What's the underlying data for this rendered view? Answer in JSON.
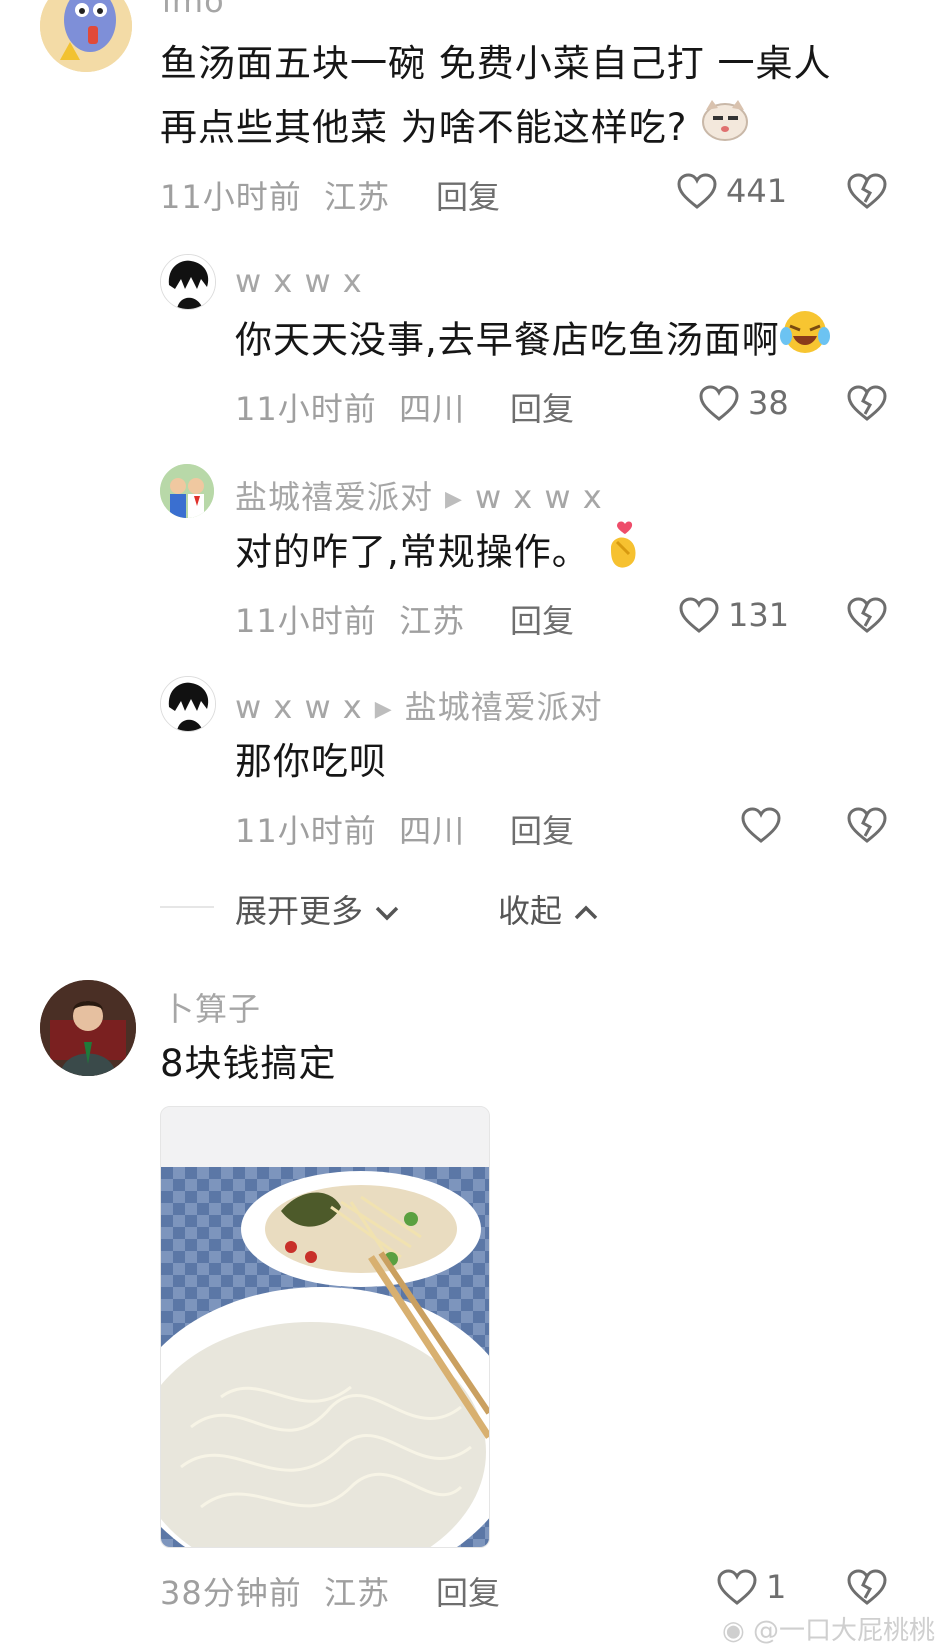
{
  "comments": [
    {
      "user": "lmo",
      "text_line1": "鱼汤面五块一碗 免费小菜自己打 一桌人",
      "text_line2": "再点些其他菜 为啥不能这样吃?",
      "time": "11小时前",
      "location": "江苏",
      "reply_label": "回复",
      "likes": "441",
      "avatar_icon": "fish-cartoon-avatar"
    },
    {
      "user": "w x w x",
      "text": "你天天没事,去早餐店吃鱼汤面啊",
      "time": "11小时前",
      "location": "四川",
      "reply_label": "回复",
      "likes": "38",
      "avatar_icon": "anime-boy-avatar"
    },
    {
      "user": "盐城禧爱派对",
      "reply_to": "w x w x",
      "text": "对的咋了,常规操作。",
      "time": "11小时前",
      "location": "江苏",
      "reply_label": "回复",
      "likes": "131",
      "avatar_icon": "kids-photo-avatar"
    },
    {
      "user": "w x w x",
      "reply_to": "盐城禧爱派对",
      "text": "那你吃呗",
      "time": "11小时前",
      "location": "四川",
      "reply_label": "回复",
      "likes": "",
      "avatar_icon": "anime-boy-avatar"
    },
    {
      "user": "卜算子",
      "text": "8块钱搞定",
      "time": "38分钟前",
      "location": "江苏",
      "reply_label": "回复",
      "likes": "1",
      "avatar_icon": "man-in-suit-avatar"
    }
  ],
  "thread_controls": {
    "expand_more": "展开更多",
    "collapse": "收起"
  },
  "watermark": "@一口大屁桃桃",
  "colors": {
    "meta_gray": "#9f9f9f",
    "name_gray": "#a6a6a6",
    "text": "#161616"
  }
}
